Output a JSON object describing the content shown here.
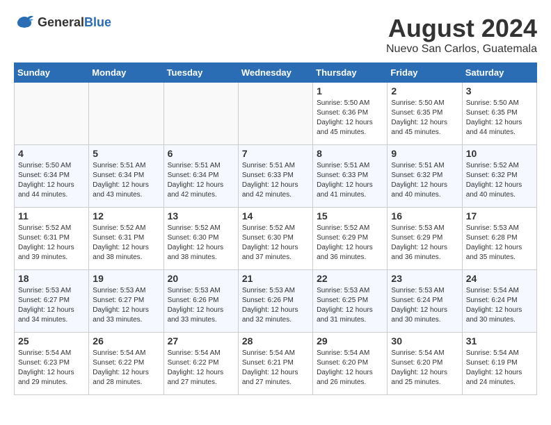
{
  "header": {
    "logo_general": "General",
    "logo_blue": "Blue",
    "title": "August 2024",
    "subtitle": "Nuevo San Carlos, Guatemala"
  },
  "weekdays": [
    "Sunday",
    "Monday",
    "Tuesday",
    "Wednesday",
    "Thursday",
    "Friday",
    "Saturday"
  ],
  "weeks": [
    [
      {
        "day": "",
        "info": ""
      },
      {
        "day": "",
        "info": ""
      },
      {
        "day": "",
        "info": ""
      },
      {
        "day": "",
        "info": ""
      },
      {
        "day": "1",
        "info": "Sunrise: 5:50 AM\nSunset: 6:36 PM\nDaylight: 12 hours\nand 45 minutes."
      },
      {
        "day": "2",
        "info": "Sunrise: 5:50 AM\nSunset: 6:35 PM\nDaylight: 12 hours\nand 45 minutes."
      },
      {
        "day": "3",
        "info": "Sunrise: 5:50 AM\nSunset: 6:35 PM\nDaylight: 12 hours\nand 44 minutes."
      }
    ],
    [
      {
        "day": "4",
        "info": "Sunrise: 5:50 AM\nSunset: 6:34 PM\nDaylight: 12 hours\nand 44 minutes."
      },
      {
        "day": "5",
        "info": "Sunrise: 5:51 AM\nSunset: 6:34 PM\nDaylight: 12 hours\nand 43 minutes."
      },
      {
        "day": "6",
        "info": "Sunrise: 5:51 AM\nSunset: 6:34 PM\nDaylight: 12 hours\nand 42 minutes."
      },
      {
        "day": "7",
        "info": "Sunrise: 5:51 AM\nSunset: 6:33 PM\nDaylight: 12 hours\nand 42 minutes."
      },
      {
        "day": "8",
        "info": "Sunrise: 5:51 AM\nSunset: 6:33 PM\nDaylight: 12 hours\nand 41 minutes."
      },
      {
        "day": "9",
        "info": "Sunrise: 5:51 AM\nSunset: 6:32 PM\nDaylight: 12 hours\nand 40 minutes."
      },
      {
        "day": "10",
        "info": "Sunrise: 5:52 AM\nSunset: 6:32 PM\nDaylight: 12 hours\nand 40 minutes."
      }
    ],
    [
      {
        "day": "11",
        "info": "Sunrise: 5:52 AM\nSunset: 6:31 PM\nDaylight: 12 hours\nand 39 minutes."
      },
      {
        "day": "12",
        "info": "Sunrise: 5:52 AM\nSunset: 6:31 PM\nDaylight: 12 hours\nand 38 minutes."
      },
      {
        "day": "13",
        "info": "Sunrise: 5:52 AM\nSunset: 6:30 PM\nDaylight: 12 hours\nand 38 minutes."
      },
      {
        "day": "14",
        "info": "Sunrise: 5:52 AM\nSunset: 6:30 PM\nDaylight: 12 hours\nand 37 minutes."
      },
      {
        "day": "15",
        "info": "Sunrise: 5:52 AM\nSunset: 6:29 PM\nDaylight: 12 hours\nand 36 minutes."
      },
      {
        "day": "16",
        "info": "Sunrise: 5:53 AM\nSunset: 6:29 PM\nDaylight: 12 hours\nand 36 minutes."
      },
      {
        "day": "17",
        "info": "Sunrise: 5:53 AM\nSunset: 6:28 PM\nDaylight: 12 hours\nand 35 minutes."
      }
    ],
    [
      {
        "day": "18",
        "info": "Sunrise: 5:53 AM\nSunset: 6:27 PM\nDaylight: 12 hours\nand 34 minutes."
      },
      {
        "day": "19",
        "info": "Sunrise: 5:53 AM\nSunset: 6:27 PM\nDaylight: 12 hours\nand 33 minutes."
      },
      {
        "day": "20",
        "info": "Sunrise: 5:53 AM\nSunset: 6:26 PM\nDaylight: 12 hours\nand 33 minutes."
      },
      {
        "day": "21",
        "info": "Sunrise: 5:53 AM\nSunset: 6:26 PM\nDaylight: 12 hours\nand 32 minutes."
      },
      {
        "day": "22",
        "info": "Sunrise: 5:53 AM\nSunset: 6:25 PM\nDaylight: 12 hours\nand 31 minutes."
      },
      {
        "day": "23",
        "info": "Sunrise: 5:53 AM\nSunset: 6:24 PM\nDaylight: 12 hours\nand 30 minutes."
      },
      {
        "day": "24",
        "info": "Sunrise: 5:54 AM\nSunset: 6:24 PM\nDaylight: 12 hours\nand 30 minutes."
      }
    ],
    [
      {
        "day": "25",
        "info": "Sunrise: 5:54 AM\nSunset: 6:23 PM\nDaylight: 12 hours\nand 29 minutes."
      },
      {
        "day": "26",
        "info": "Sunrise: 5:54 AM\nSunset: 6:22 PM\nDaylight: 12 hours\nand 28 minutes."
      },
      {
        "day": "27",
        "info": "Sunrise: 5:54 AM\nSunset: 6:22 PM\nDaylight: 12 hours\nand 27 minutes."
      },
      {
        "day": "28",
        "info": "Sunrise: 5:54 AM\nSunset: 6:21 PM\nDaylight: 12 hours\nand 27 minutes."
      },
      {
        "day": "29",
        "info": "Sunrise: 5:54 AM\nSunset: 6:20 PM\nDaylight: 12 hours\nand 26 minutes."
      },
      {
        "day": "30",
        "info": "Sunrise: 5:54 AM\nSunset: 6:20 PM\nDaylight: 12 hours\nand 25 minutes."
      },
      {
        "day": "31",
        "info": "Sunrise: 5:54 AM\nSunset: 6:19 PM\nDaylight: 12 hours\nand 24 minutes."
      }
    ]
  ]
}
